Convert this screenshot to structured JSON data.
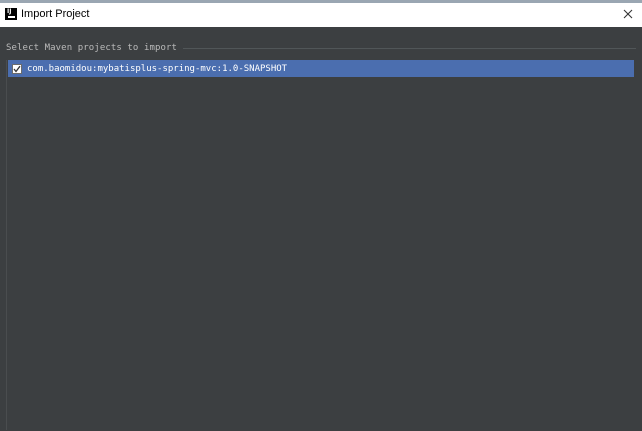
{
  "window": {
    "title": "Import Project",
    "app_icon": "intellij-icon",
    "close_icon": "close-icon"
  },
  "section": {
    "label": "Select Maven projects to import"
  },
  "projects": [
    {
      "label": "com.baomidou:mybatisplus-spring-mvc:1.0-SNAPSHOT",
      "checked": true,
      "selected": true
    }
  ],
  "colors": {
    "background": "#3c3f41",
    "selection": "#4b6eaf",
    "text": "#bbbbbb"
  }
}
